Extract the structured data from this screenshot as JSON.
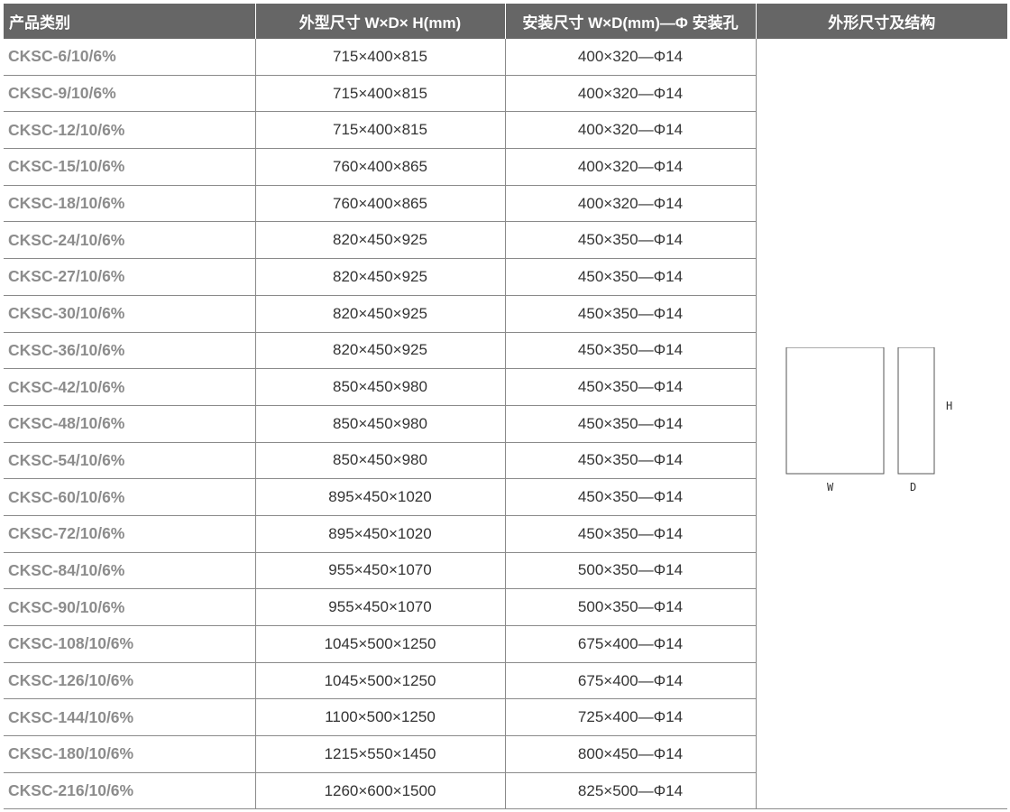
{
  "table": {
    "headers": [
      "产品类别",
      "外型尺寸 W×D× H(mm)",
      "安装尺寸 W×D(mm)—Φ 安装孔",
      "外形尺寸及结构"
    ],
    "rows": [
      {
        "model": "CKSC-6/10/6%",
        "outer": "715×400×815",
        "mount": "400×320—Φ14"
      },
      {
        "model": "CKSC-9/10/6%",
        "outer": "715×400×815",
        "mount": "400×320—Φ14"
      },
      {
        "model": "CKSC-12/10/6%",
        "outer": "715×400×815",
        "mount": "400×320—Φ14"
      },
      {
        "model": "CKSC-15/10/6%",
        "outer": "760×400×865",
        "mount": "400×320—Φ14"
      },
      {
        "model": "CKSC-18/10/6%",
        "outer": "760×400×865",
        "mount": "400×320—Φ14"
      },
      {
        "model": "CKSC-24/10/6%",
        "outer": "820×450×925",
        "mount": "450×350—Φ14"
      },
      {
        "model": "CKSC-27/10/6%",
        "outer": "820×450×925",
        "mount": "450×350—Φ14"
      },
      {
        "model": "CKSC-30/10/6%",
        "outer": "820×450×925",
        "mount": "450×350—Φ14"
      },
      {
        "model": "CKSC-36/10/6%",
        "outer": "820×450×925",
        "mount": "450×350—Φ14"
      },
      {
        "model": "CKSC-42/10/6%",
        "outer": "850×450×980",
        "mount": "450×350—Φ14"
      },
      {
        "model": "CKSC-48/10/6%",
        "outer": "850×450×980",
        "mount": "450×350—Φ14"
      },
      {
        "model": "CKSC-54/10/6%",
        "outer": "850×450×980",
        "mount": "450×350—Φ14"
      },
      {
        "model": "CKSC-60/10/6%",
        "outer": "895×450×1020",
        "mount": "450×350—Φ14"
      },
      {
        "model": "CKSC-72/10/6%",
        "outer": "895×450×1020",
        "mount": "450×350—Φ14"
      },
      {
        "model": "CKSC-84/10/6%",
        "outer": "955×450×1070",
        "mount": "500×350—Φ14"
      },
      {
        "model": "CKSC-90/10/6%",
        "outer": "955×450×1070",
        "mount": "500×350—Φ14"
      },
      {
        "model": "CKSC-108/10/6%",
        "outer": "1045×500×1250",
        "mount": "675×400—Φ14"
      },
      {
        "model": "CKSC-126/10/6%",
        "outer": "1045×500×1250",
        "mount": "675×400—Φ14"
      },
      {
        "model": "CKSC-144/10/6%",
        "outer": "1100×500×1250",
        "mount": "725×400—Φ14"
      },
      {
        "model": "CKSC-180/10/6%",
        "outer": "1215×550×1450",
        "mount": "800×450—Φ14"
      },
      {
        "model": "CKSC-216/10/6%",
        "outer": "1260×600×1500",
        "mount": "825×500—Φ14"
      }
    ]
  },
  "diagram": {
    "labels": {
      "width": "W",
      "depth": "D",
      "height": "H"
    }
  }
}
